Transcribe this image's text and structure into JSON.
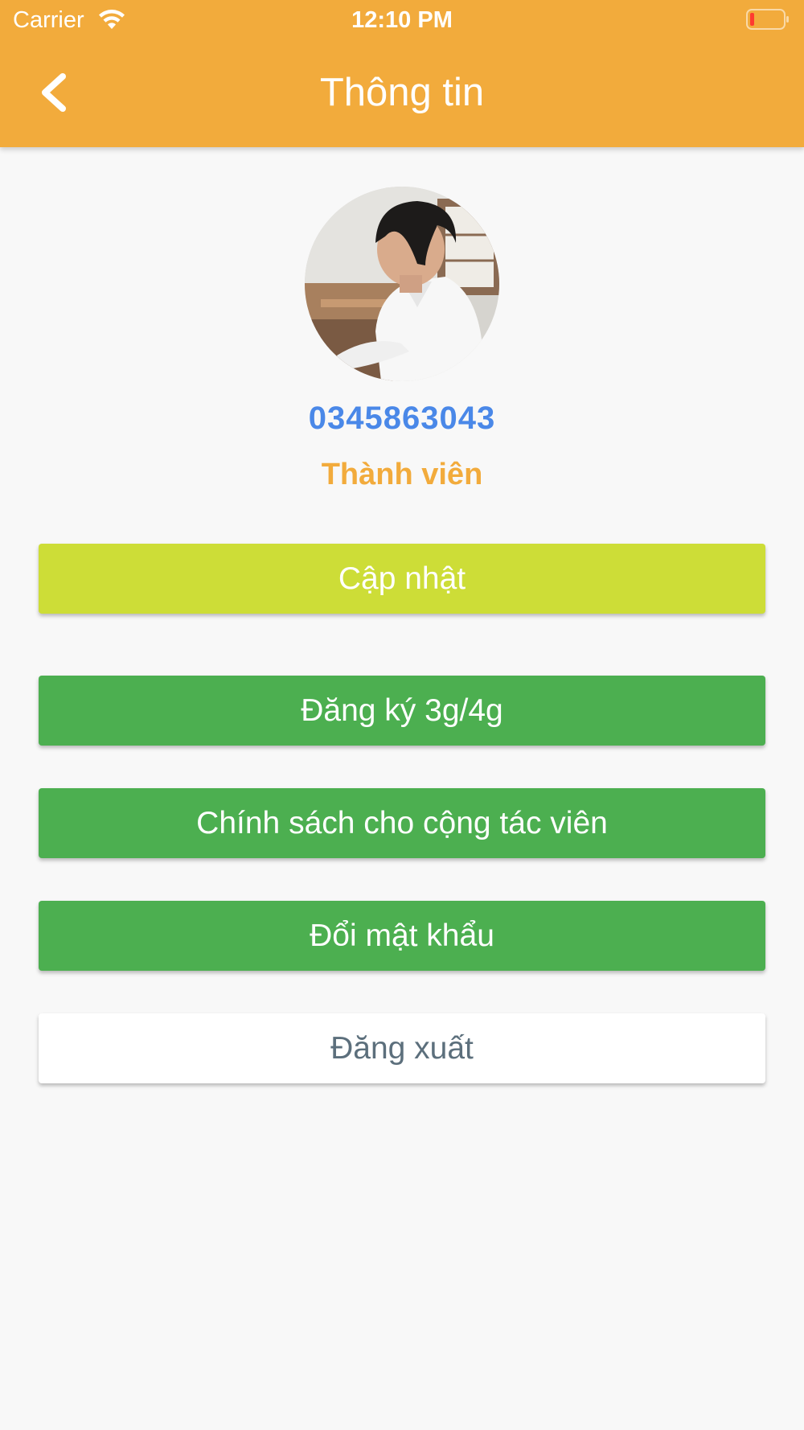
{
  "status_bar": {
    "carrier": "Carrier",
    "time": "12:10 PM",
    "wifi_icon": "wifi-icon",
    "battery_icon": "battery-low-icon",
    "battery_color": "#ff3b30"
  },
  "header": {
    "title": "Thông tin",
    "back_icon": "chevron-left-icon",
    "background": "#f2ab3c"
  },
  "profile": {
    "avatar": "profile-photo",
    "phone": "0345863043",
    "role": "Thành viên",
    "phone_color": "#4a88e8",
    "role_color": "#f2ab3c"
  },
  "buttons": {
    "update": "Cập nhật",
    "register_3g4g": "Đăng ký 3g/4g",
    "collaborator_policy": "Chính sách cho cộng tác viên",
    "change_password": "Đổi mật khẩu",
    "logout": "Đăng xuất"
  },
  "colors": {
    "update_button": "#cddd37",
    "primary_green": "#4caf50",
    "logout_text": "#5c6f7c",
    "background": "#f8f8f8"
  }
}
